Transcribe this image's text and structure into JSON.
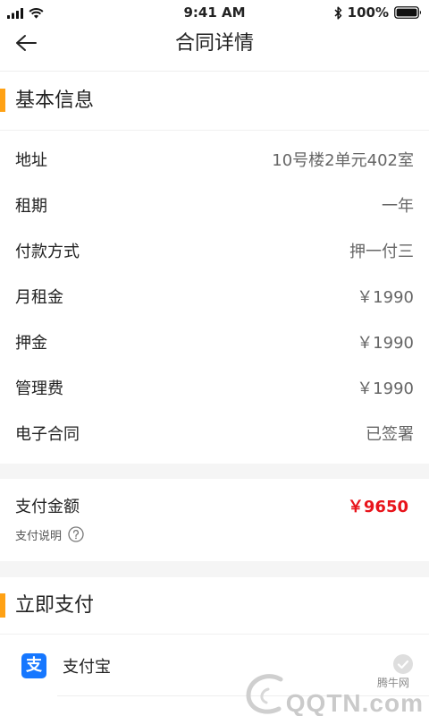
{
  "status_bar": {
    "time": "9:41 AM",
    "battery_text": "100%",
    "icons": [
      "signal-icon",
      "wifi-icon",
      "bluetooth-icon",
      "battery-icon"
    ]
  },
  "nav": {
    "back_icon": "back-arrow-icon",
    "title": "合同详情"
  },
  "basic_info": {
    "title": "基本信息",
    "rows": [
      {
        "label": "地址",
        "value": "10号楼2单元402室"
      },
      {
        "label": "租期",
        "value": "一年"
      },
      {
        "label": "付款方式",
        "value": "押一付三"
      },
      {
        "label": "月租金",
        "value": "￥1990"
      },
      {
        "label": "押金",
        "value": "￥1990"
      },
      {
        "label": "管理费",
        "value": "￥1990"
      },
      {
        "label": "电子合同",
        "value": "已签署"
      }
    ]
  },
  "payment_summary": {
    "label": "支付金额",
    "amount": "￥9650",
    "note": "支付说明",
    "note_icon": "help-circle-icon"
  },
  "pay_now": {
    "title": "立即支付",
    "methods": [
      {
        "name": "支付宝",
        "icon": "alipay-icon",
        "icon_glyph": "支",
        "check_icon": "check-circle-icon"
      }
    ]
  },
  "watermark": {
    "site_name": "腾牛网",
    "domain": "QQTN.com",
    "logo_icon": "qqtn-logo-icon"
  },
  "colors": {
    "accent": "#FFA114",
    "amount": "#E8141B",
    "alipay_blue": "#1677FF",
    "value_text": "#666666",
    "separator": "#F5F5F5"
  }
}
